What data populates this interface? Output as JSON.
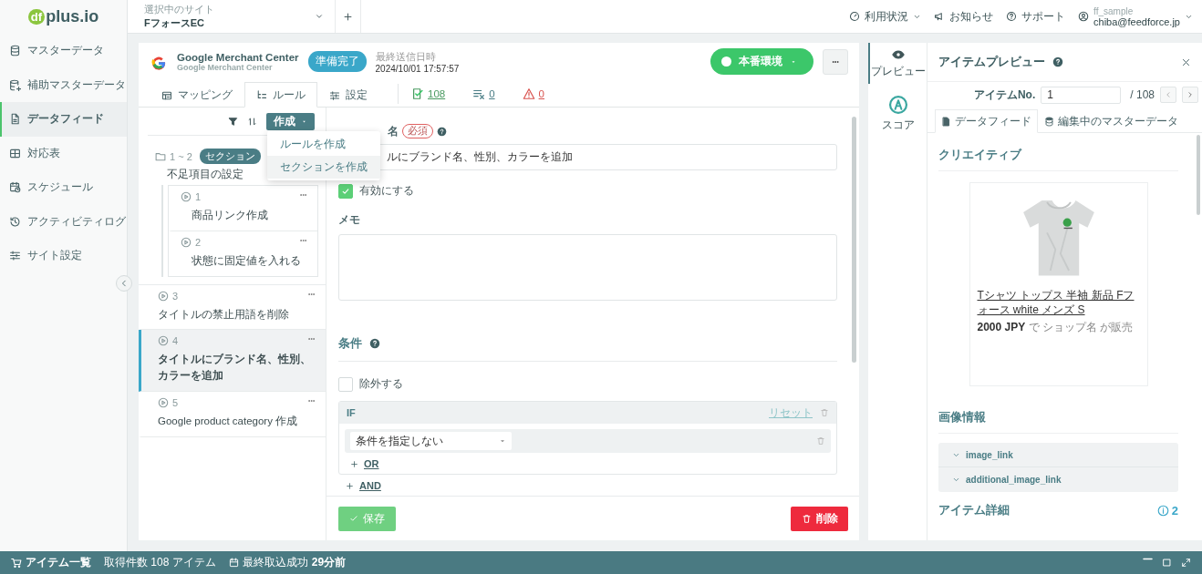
{
  "logo": {
    "mark": "df",
    "text": "plus.io"
  },
  "site": {
    "label": "選択中のサイト",
    "name": "FフォースEC"
  },
  "top_nav": [
    {
      "label": "利用状況",
      "kind": "dropdown"
    },
    {
      "label": "お知らせ",
      "kind": "news"
    },
    {
      "label": "サポート",
      "kind": "help"
    }
  ],
  "user": {
    "account": "ff_sample",
    "email": "chiba@feedforce.jp"
  },
  "sidebar": {
    "items": [
      {
        "label": "マスターデータ",
        "selected": false
      },
      {
        "label": "補助マスターデータ",
        "selected": false
      },
      {
        "label": "データフィード",
        "selected": true
      },
      {
        "label": "対応表",
        "selected": false
      },
      {
        "label": "スケジュール",
        "selected": false
      },
      {
        "label": "アクティビティログ",
        "selected": false
      },
      {
        "label": "サイト設定",
        "selected": false
      }
    ]
  },
  "feed": {
    "title": "Google Merchant Center",
    "subtitle": "Google Merchant Center",
    "status": "準備完了",
    "last_sent_label": "最終送信日時",
    "last_sent": "2024/10/01 17:57:57",
    "environment": "本番環境"
  },
  "tabs": [
    {
      "label": "マッピング",
      "selected": false
    },
    {
      "label": "ルール",
      "selected": true
    },
    {
      "label": "設定",
      "selected": false
    }
  ],
  "counters": [
    {
      "kind": "ok",
      "value": "108"
    },
    {
      "kind": "excluded",
      "value": "0"
    },
    {
      "kind": "error",
      "value": "0"
    }
  ],
  "rules": {
    "create_button": "作成",
    "menu": [
      "ルールを作成",
      "セクションを作成"
    ],
    "items": [
      {
        "kind": "section",
        "number": "1 ~ 2",
        "badge": "セクション",
        "title": "不足項目の設定",
        "selected": false,
        "children": [
          {
            "kind": "rule",
            "number": "1",
            "title": "商品リンク作成",
            "selected": false
          },
          {
            "kind": "rule",
            "number": "2",
            "title": "状態に固定値を入れる",
            "selected": false
          }
        ]
      },
      {
        "kind": "rule",
        "number": "3",
        "title": "タイトルの禁止用語を削除",
        "selected": false
      },
      {
        "kind": "rule",
        "number": "4",
        "title": "タイトルにブランド名、性別、カラーを追加",
        "selected": true
      },
      {
        "kind": "rule",
        "number": "5",
        "title": "Google product category 作成",
        "selected": false
      }
    ]
  },
  "form": {
    "name_label": "名",
    "required": "必須",
    "name_value": "ルにブランド名、性別、カラーを追加",
    "enabled": {
      "label": "有効にする",
      "checked": true
    },
    "memo_label": "メモ",
    "conditions": {
      "heading": "条件",
      "exclude": {
        "label": "除外する",
        "checked": false
      },
      "if_label": "IF",
      "reset": "リセット",
      "condition_value": "条件を指定しない",
      "or": "OR",
      "and": "AND"
    },
    "save": "保存",
    "delete": "削除"
  },
  "preview": {
    "rail": [
      {
        "label": "プレビュー",
        "selected": true
      },
      {
        "label": "スコア",
        "selected": false
      }
    ],
    "title": "アイテムプレビュー",
    "item_no_label": "アイテムNo.",
    "item_no": "1",
    "total": "/ 108",
    "tabs": [
      {
        "label": "データフィード",
        "selected": true
      },
      {
        "label": "編集中のマスターデータ",
        "selected": false
      }
    ],
    "creative_heading": "クリエイティブ",
    "product": {
      "title": "Tシャツ トップス 半袖 新品 Fフォース white メンズ S",
      "price_line": "**2000 JPY** で ショップ名 が販売"
    },
    "image_heading": "画像情報",
    "image_fields": [
      "image_link",
      "additional_image_link"
    ],
    "details_heading": "アイテム詳細",
    "details_count": "2"
  },
  "status_bar": {
    "items_link": "アイテム一覧",
    "count_text": "取得件数 108 アイテム",
    "last_import_label": "最終取込成功",
    "last_import": "29分前"
  }
}
